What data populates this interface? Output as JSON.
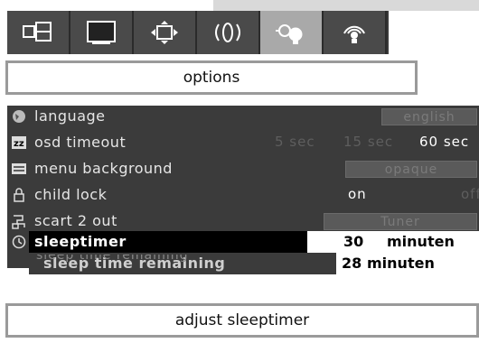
{
  "tabs": [
    {
      "icon": "picture-layout-icon",
      "active": false
    },
    {
      "icon": "screen-icon",
      "active": false
    },
    {
      "icon": "picture-size-icon",
      "active": false
    },
    {
      "icon": "sound-icon",
      "active": false
    },
    {
      "icon": "options-icon",
      "active": true
    },
    {
      "icon": "antenna-icon",
      "active": false
    }
  ],
  "header": {
    "title": "options"
  },
  "menu": {
    "language": {
      "label": "language",
      "value": "english"
    },
    "osd_timeout": {
      "label": "osd timeout",
      "options": [
        "5 sec",
        "15 sec",
        "60 sec"
      ],
      "selected": "60 sec"
    },
    "menu_background": {
      "label": "menu background",
      "value": "opaque"
    },
    "child_lock": {
      "label": "child lock",
      "options": [
        "on",
        "off"
      ],
      "selected": "on"
    },
    "scart2": {
      "label": "scart 2 out",
      "value": "Tuner"
    },
    "sleeptimer": {
      "label": "sleeptimer",
      "value": "30",
      "unit": "minuten"
    },
    "remaining": {
      "label": "sleep time remaining",
      "value": "28",
      "unit": "minuten"
    }
  },
  "ghost_text": "sleep time remaining",
  "footer": {
    "hint": "adjust sleeptimer"
  },
  "colors": {
    "panel": "#3b3b3b",
    "selected_label_bg": "#000000",
    "selected_value_bg": "#ffffff",
    "disabled_text": "#5e5e5e"
  }
}
